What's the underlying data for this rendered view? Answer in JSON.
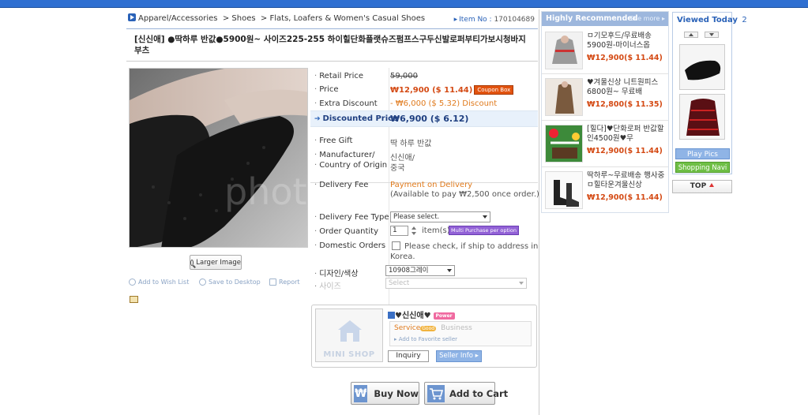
{
  "breadcrumb": [
    "Apparel/Accessories",
    "Shoes",
    "Flats, Loafers & Women's Casual Shoes"
  ],
  "item_no": {
    "label": "Item No :",
    "value": "170104689"
  },
  "title": "[신신애] ●딱하루 반값●5900원~ 사이즈225-255 하이힐단화플랫슈즈펌프스구두신발로퍼부티가보시청바지부츠",
  "photo": {
    "watermark": "photo"
  },
  "larger_image_label": "Larger Image",
  "utilities": {
    "wish": "Add to Wish List",
    "desktop": "Save to Desktop",
    "report": "Report"
  },
  "prices": {
    "retail_label": "Retail Price",
    "retail_value": "59,000",
    "price_label": "Price",
    "price_value": "₩12,900 ($ 11.44)",
    "coupon_label": "Coupon Box",
    "extra_label": "Extra Discount",
    "extra_value": "- ₩6,000 ($ 5.32) Discount",
    "discounted_label": "Discounted Price",
    "discounted_value": "₩6,900 ($ 6.12)"
  },
  "details": {
    "gift_label": "Free Gift",
    "gift_value": "딱 하루 반값",
    "manufacturer_label": "Manufacturer/",
    "origin_label": "Country of Origin",
    "manufacturer_value": "신신애/",
    "origin_value": "중국",
    "delivery_label": "Delivery Fee",
    "delivery_value_1": "Payment on Delivery",
    "delivery_value_2": "(Available to pay ₩2,500 once order.)",
    "fee_type_label": "Delivery Fee Type",
    "fee_type_value": "Please select.",
    "qty_label": "Order Quantity",
    "qty_value": "1",
    "qty_unit": "item(s)",
    "multi_label": "Multi Purchase per option",
    "domestic_label": "Domestic Orders",
    "domestic_text_1": "Please check, if ship to address in",
    "domestic_text_2": "Korea.",
    "option1_label": "디자인/색상",
    "option1_value": "10908그레이",
    "option2_label": "사이즈",
    "option2_value": "Select"
  },
  "shop": {
    "mini_shop_label": "MINI SHOP",
    "seller_name": "♥신신애♥",
    "seller_badge": "Power",
    "service_label": "Service",
    "good_label": "Good",
    "business_label": "Business",
    "favorite_label": "Add to Favorite seller",
    "inquiry_label": "Inquiry",
    "seller_info_label": "Seller Info"
  },
  "actions": {
    "buy_now": "Buy Now",
    "buy_icon": "₩",
    "add_to_cart": "Add to Cart"
  },
  "recommended": {
    "title": "Highly Recommended",
    "more": "See more",
    "items": [
      {
        "name": "ㅁ기모후드/무료배송5900원-마이너스옵",
        "price": "₩12,900($ 11.44)"
      },
      {
        "name": "♥겨울신상 니트원피스6800원~ 무료배",
        "price": "₩12,800($ 11.35)"
      },
      {
        "name": "[힐다]♥단화로퍼 반값할인4500원♥무",
        "price": "₩12,900($ 11.44)"
      },
      {
        "name": "딱하루~무료배송 행사중ㅁ힐타운겨울신상",
        "price": "₩12,900($ 11.44)"
      }
    ]
  },
  "viewed_today": {
    "title": "Viewed Today",
    "count": "2",
    "play_pics": "Play Pics",
    "shopping_navi": "Shopping Navi"
  },
  "top_button": "TOP",
  "colors": {
    "accent": "#2a62b8",
    "price_red": "#d44a14",
    "header_blue": "#9db7dd",
    "green": "#6fbf46"
  }
}
